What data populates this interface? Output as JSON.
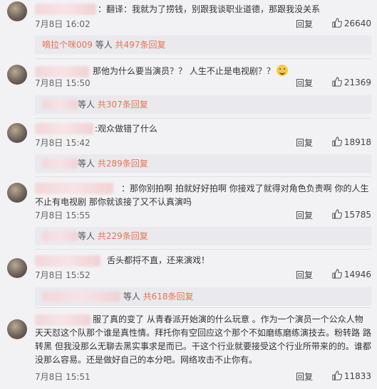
{
  "comments": [
    {
      "text": "：翻译：我就为了捞钱，别跟我谈职业道德，那跟我没关系",
      "time": "7月8日 16:02",
      "reply": "回复",
      "likes": "26640",
      "sub_prefix": "嘀拉个咪009",
      "sub_middle": " 等人 ",
      "sub_link": "共497条回复"
    },
    {
      "text": "那他为什么要当演员？？ 人生不止是电视剧？？",
      "time": "7月8日 15:50",
      "reply": "回复",
      "likes": "21369",
      "sub_middle": "等人 ",
      "sub_link": "共307条回复"
    },
    {
      "text": ":观众做错了什么",
      "time": "7月8日 15:42",
      "reply": "回复",
      "likes": "18918",
      "sub_middle": "等人 ",
      "sub_link": "共289条回复"
    },
    {
      "text": "：那你别拍啊 拍就好好拍啊 你接戏了就得对角色负责啊 你的人生不止有电视剧 那你就该接了又不认真演吗",
      "time": "7月8日 15:55",
      "reply": "回复",
      "likes": "15785",
      "sub_middle": "等人 ",
      "sub_link": "共229条回复"
    },
    {
      "text": "舌头都捋不直，还来演戏！",
      "time": "7月8日 15:52",
      "reply": "回复",
      "likes": "14946",
      "sub_middle": " 等人 ",
      "sub_link": "共618条回复"
    },
    {
      "text": "服了真的变了 从青春派开始演的什么玩意 。作为一个演员一个公众人物 天天怼这个队那个谁是真性情。拜托你有空回应这个那个不如磨练磨练演技去。粉转路 路转黑 但我没那么无聊去黑实事求是而已。干这个行业就要接受这个行业所带来的的。谁都没那么容易。还是做好自己的本分吧。网络攻击不止你有。",
      "time": "7月8日 15:51",
      "reply": "回复",
      "likes": "11833"
    }
  ],
  "colors": {
    "link": "#eb7350",
    "background": "#f2f2f5"
  },
  "icons": {
    "like": "thumbs-up-icon",
    "emoji": "grin-emoji-icon"
  }
}
